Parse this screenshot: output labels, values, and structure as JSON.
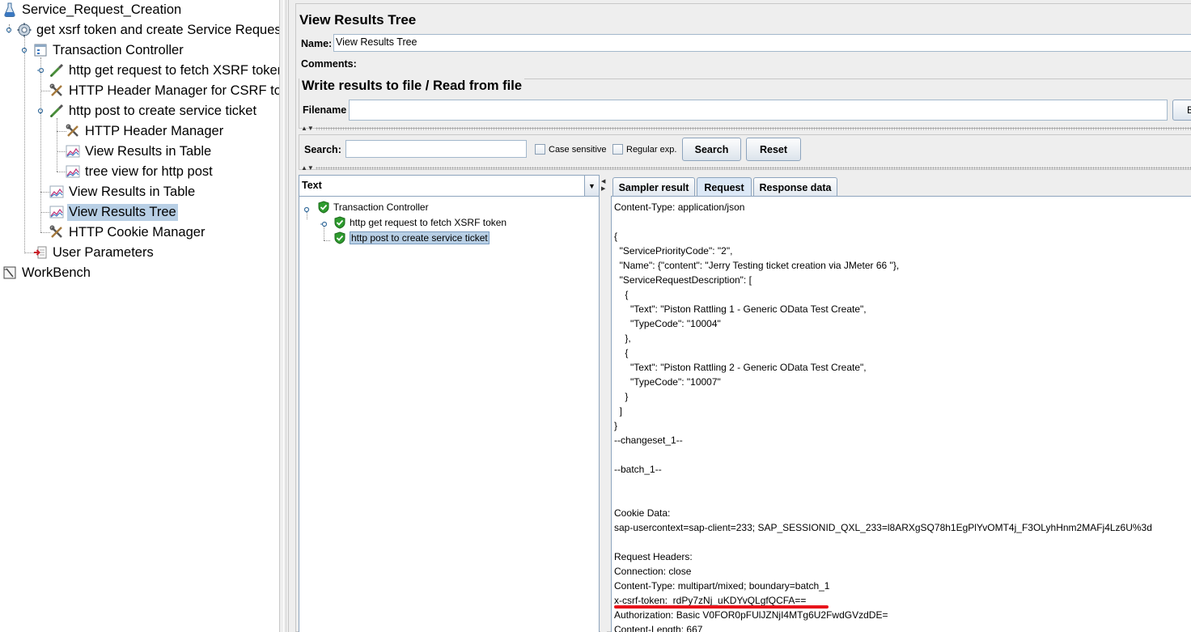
{
  "plan_tree": {
    "nodes": [
      {
        "label": "Service_Request_Creation",
        "icon": "test-plan-flask-icon"
      },
      {
        "label": "get xsrf token and create Service Reques",
        "icon": "thread-group-gear-icon"
      },
      {
        "label": "Transaction Controller",
        "icon": "transaction-controller-icon"
      },
      {
        "label": "http get request to fetch XSRF token",
        "icon": "sampler-pipette-icon"
      },
      {
        "label": "HTTP Header Manager for CSRF to",
        "icon": "config-tools-icon"
      },
      {
        "label": "http post to create service ticket",
        "icon": "sampler-pipette-icon"
      },
      {
        "label": "HTTP Header Manager",
        "icon": "config-tools-icon"
      },
      {
        "label": "View Results in Table",
        "icon": "listener-chart-icon"
      },
      {
        "label": "tree view for http post",
        "icon": "listener-chart-icon"
      },
      {
        "label": "View Results in Table",
        "icon": "listener-chart-icon"
      },
      {
        "label": "View Results Tree",
        "icon": "listener-chart-icon"
      },
      {
        "label": "HTTP Cookie Manager",
        "icon": "config-tools-icon"
      },
      {
        "label": "User Parameters",
        "icon": "pre-processor-icon"
      },
      {
        "label": "WorkBench",
        "icon": "workbench-icon"
      }
    ]
  },
  "panel": {
    "title": "View Results Tree",
    "name_label": "Name:",
    "name_value": "View Results Tree",
    "comments_label": "Comments:",
    "file_section_title": "Write results to file / Read from file",
    "filename_label": "Filename",
    "filename_value": "",
    "browse_label": "B"
  },
  "search": {
    "label": "Search:",
    "value": "",
    "case_sensitive_label": "Case sensitive",
    "regex_label": "Regular exp.",
    "search_button": "Search",
    "reset_button": "Reset"
  },
  "results": {
    "renderer": "Text",
    "tree": [
      {
        "label": "Transaction Controller",
        "status": "success"
      },
      {
        "label": "http get request to fetch XSRF token",
        "status": "success"
      },
      {
        "label": "http post to create service ticket",
        "status": "success"
      }
    ]
  },
  "tabs": [
    "Sampler result",
    "Request",
    "Response data"
  ],
  "request_lines": [
    "Content-Type: application/json",
    "",
    "{",
    "  \"ServicePriorityCode\": \"2\",",
    "  \"Name\": {\"content\": \"Jerry Testing ticket creation via JMeter 66 \"},",
    "  \"ServiceRequestDescription\": [",
    "    {",
    "      \"Text\": \"Piston Rattling 1 - Generic OData Test Create\",",
    "      \"TypeCode\": \"10004\"",
    "    },",
    "    {",
    "      \"Text\": \"Piston Rattling 2 - Generic OData Test Create\",",
    "      \"TypeCode\": \"10007\"",
    "    }",
    "  ]",
    "}",
    "--changeset_1--",
    "",
    "--batch_1--",
    "",
    "",
    "Cookie Data:",
    "sap-usercontext=sap-client=233; SAP_SESSIONID_QXL_233=l8ARXgSQ78h1EgPlYvOMT4j_F3OLyhHnm2MAFj4Lz6U%3d",
    "",
    "Request Headers:",
    "Connection: close",
    "Content-Type: multipart/mixed; boundary=batch_1",
    "x-csrf-token:  rdPy7zNj_uKDYvQLgfQCFA==",
    "Authorization: Basic V0FOR0pFUlJZNjI4MTg6U2FwdGVzdDE=",
    "Content-Length: 667"
  ],
  "colors": {
    "selection": "#b8cfe5",
    "panel_bg": "#eeeeee",
    "highlight_underline": "#e8141b",
    "success_green": "#2e9b2e"
  }
}
